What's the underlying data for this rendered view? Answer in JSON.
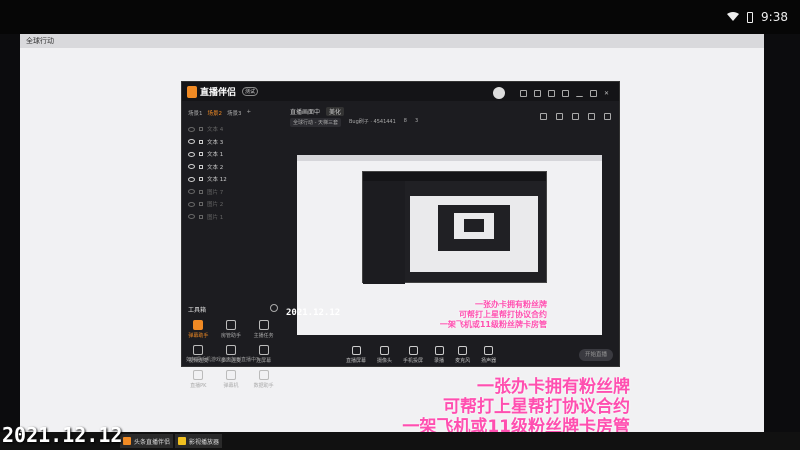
{
  "statusbar": {
    "time": "9:38"
  },
  "window": {
    "title": "全球行动"
  },
  "app": {
    "name": "直播伴侣",
    "badge": "测试",
    "scene_tabs": [
      "场景1",
      "场景2",
      "场景3"
    ],
    "sources": [
      {
        "label": "文本 4",
        "dim": true
      },
      {
        "label": "文本 3",
        "dim": false
      },
      {
        "label": "文本 1",
        "dim": false
      },
      {
        "label": "文本 2",
        "dim": false
      },
      {
        "label": "文本 12",
        "dim": false
      },
      {
        "label": "图片 7",
        "dim": true
      },
      {
        "label": "图片 2",
        "dim": true
      },
      {
        "label": "图片 1",
        "dim": true
      }
    ],
    "toolbox_title": "工具箱",
    "tools": [
      {
        "label": "弹幕助手",
        "hot": true
      },
      {
        "label": "房管助手",
        "hot": false
      },
      {
        "label": "主播任务",
        "hot": false
      },
      {
        "label": "视频连麦",
        "hot": false
      },
      {
        "label": "多人连麦",
        "hot": false
      },
      {
        "label": "连屏幕",
        "hot": false
      },
      {
        "label": "直播PK",
        "hot": false
      },
      {
        "label": "弹幕机",
        "hot": false
      },
      {
        "label": "数据助手",
        "hot": false
      }
    ],
    "left_footer": "如何把手机游戏画面加到直播中?",
    "main_tabs": [
      "直播画面中",
      "美化"
    ],
    "info": {
      "item1": "全球行动 - 天梯三套",
      "item2": "Bug刷子 · 4541441",
      "item3": "8",
      "item4": "3"
    },
    "controls": [
      "直播屏幕",
      "摄像头",
      "手机投屏",
      "录播",
      "麦克风",
      "扬声器"
    ],
    "start_label": "开始直播"
  },
  "inner_caption": {
    "line1": "一张办卡拥有粉丝牌",
    "line2": "可帮打上星帮打协议合约",
    "line3": "一架飞机或11级粉丝牌卡房管"
  },
  "inner_date": "2021.12.12",
  "caption": {
    "line1": "一张办卡拥有粉丝牌",
    "line2": "可帮打上星帮打协议合约",
    "line3": "一架飞机或11级粉丝牌卡房管"
  },
  "date": "2021.12.12",
  "taskbar": {
    "app1": "头条直播伴侣",
    "app2": "影视播放器"
  }
}
